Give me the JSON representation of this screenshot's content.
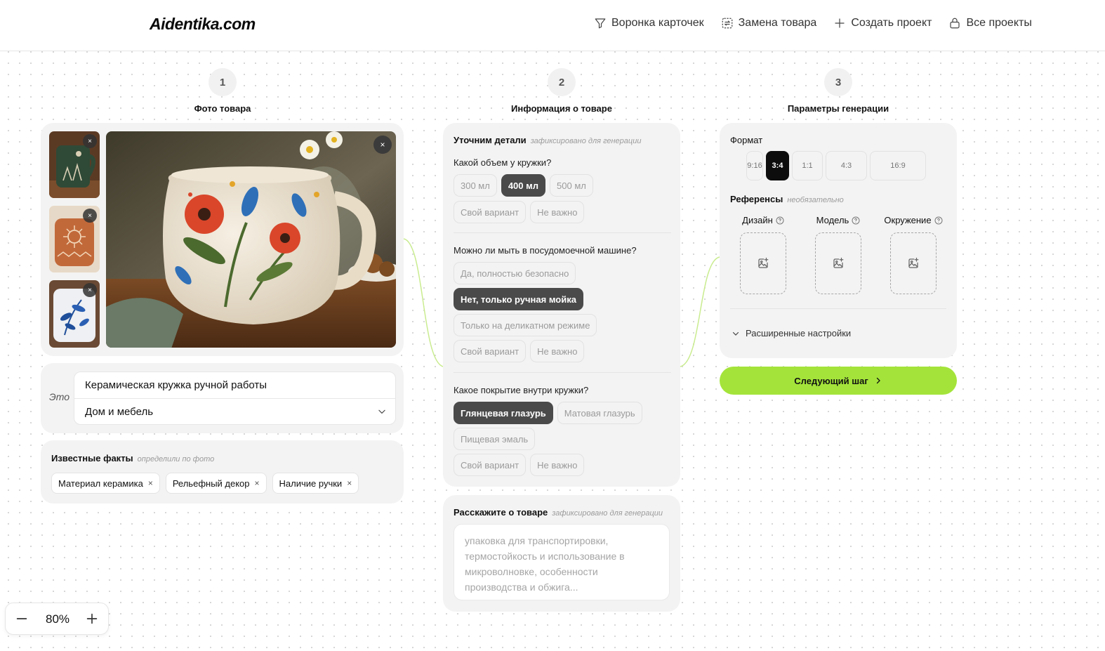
{
  "header": {
    "logo": "Aidentika.com",
    "nav": [
      {
        "label": "Воронка карточек",
        "icon": "funnel-icon"
      },
      {
        "label": "Замена товара",
        "icon": "swap-icon"
      },
      {
        "label": "Создать проект",
        "icon": "plus-icon"
      },
      {
        "label": "Все проекты",
        "icon": "lock-icon"
      }
    ]
  },
  "steps": [
    {
      "num": "1",
      "title": "Фото товара"
    },
    {
      "num": "2",
      "title": "Информация о товаре"
    },
    {
      "num": "3",
      "title": "Параметры генерации"
    }
  ],
  "photos": {
    "remove_label": "×",
    "thumbnails": [
      "green-mug-thumbnail",
      "terracotta-mug-thumbnail",
      "blue-floral-mug-thumbnail"
    ],
    "main": "floral-mug-photo"
  },
  "product": {
    "this_label": "Это",
    "name": "Керамическая кружка ручной работы",
    "category": "Дом и мебель"
  },
  "facts": {
    "title": "Известные факты",
    "note": "определили по фото",
    "remove_label": "×",
    "items": [
      "Материал керамика",
      "Рельефный декор",
      "Наличие ручки"
    ]
  },
  "details": {
    "title": "Уточним детали",
    "note": "зафиксировано для генерации",
    "questions": [
      {
        "q": "Какой объем у кружки?",
        "options": [
          "300 мл",
          "400 мл",
          "500 мл",
          "Свой вариант",
          "Не важно"
        ],
        "selected": "400 мл"
      },
      {
        "q": "Можно ли мыть в посудомоечной машине?",
        "options": [
          "Да, полностью безопасно",
          "Нет, только ручная мойка",
          "Только на деликатном режиме",
          "Свой вариант",
          "Не важно"
        ],
        "selected": "Нет, только ручная мойка"
      },
      {
        "q": "Какое покрытие внутри кружки?",
        "options": [
          "Глянцевая глазурь",
          "Матовая глазурь",
          "Пищевая эмаль",
          "Свой вариант",
          "Не важно"
        ],
        "selected": "Глянцевая глазурь"
      }
    ]
  },
  "about": {
    "title": "Расскажите о товаре",
    "note": "зафиксировано для генерации",
    "placeholder": "упаковка для транспортировки, термостойкость и использование в микроволновке, особенности производства и обжига..."
  },
  "generation": {
    "format_label": "Формат",
    "formats": [
      "9:16",
      "3:4",
      "1:1",
      "4:3",
      "16:9"
    ],
    "selected_format": "3:4",
    "refs_title": "Референсы",
    "refs_note": "необязательно",
    "refs": [
      "Дизайн",
      "Модель",
      "Окружение"
    ],
    "advanced": "Расширенные настройки",
    "next": "Следующий шаг"
  },
  "zoom": {
    "value": "80%"
  },
  "colors": {
    "accent": "#a4e43a",
    "selected_chip": "#4a4a4a",
    "connector": "#c9ec8f"
  }
}
